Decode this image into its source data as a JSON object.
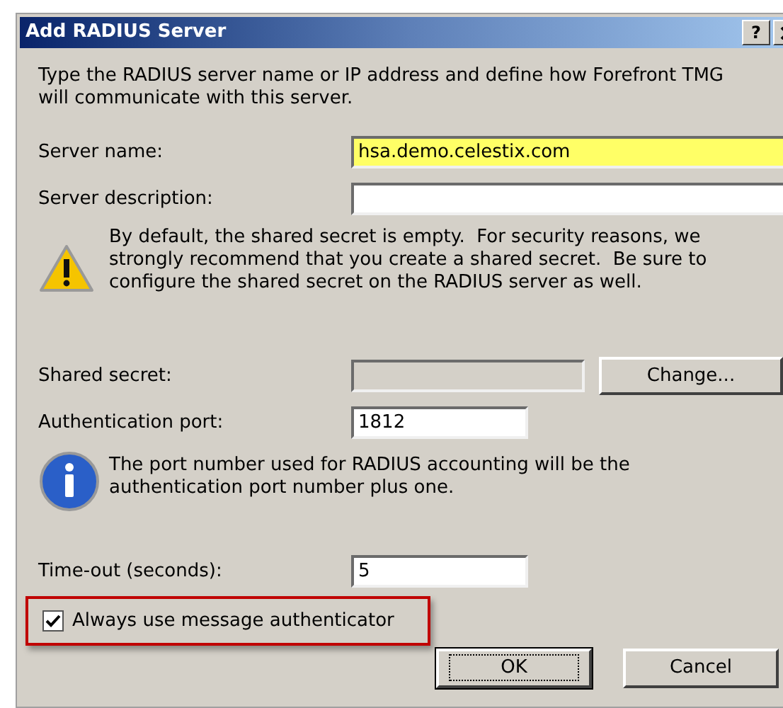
{
  "window": {
    "title": "Add RADIUS Server",
    "help_button": "?"
  },
  "intro": "Type the RADIUS server name or IP address and define how Forefront TMG will communicate with this server.",
  "server_name": {
    "label": "Server name:",
    "value": "hsa.demo.celestix.com",
    "highlighted": true
  },
  "server_description": {
    "label": "Server description:"
  },
  "warning": "By default, the shared secret is empty.  For security reasons, we strongly recommend that you create a shared secret.  Be sure to configure the shared secret on the RADIUS server as well.",
  "shared_secret": {
    "label": "Shared secret:",
    "disabled": true,
    "button": "Change..."
  },
  "auth_port": {
    "label": "Authentication port:",
    "value": "1812"
  },
  "info": "The port number used for RADIUS accounting will be the authentication port number plus one.",
  "timeout": {
    "label": "Time-out (seconds):",
    "value": "5"
  },
  "authenticator": {
    "label": "Always use message authenticator",
    "checked": true,
    "highlighted": true
  },
  "buttons": [
    {
      "label": "OK",
      "default": true
    },
    {
      "label": "Cancel",
      "default": false
    }
  ]
}
